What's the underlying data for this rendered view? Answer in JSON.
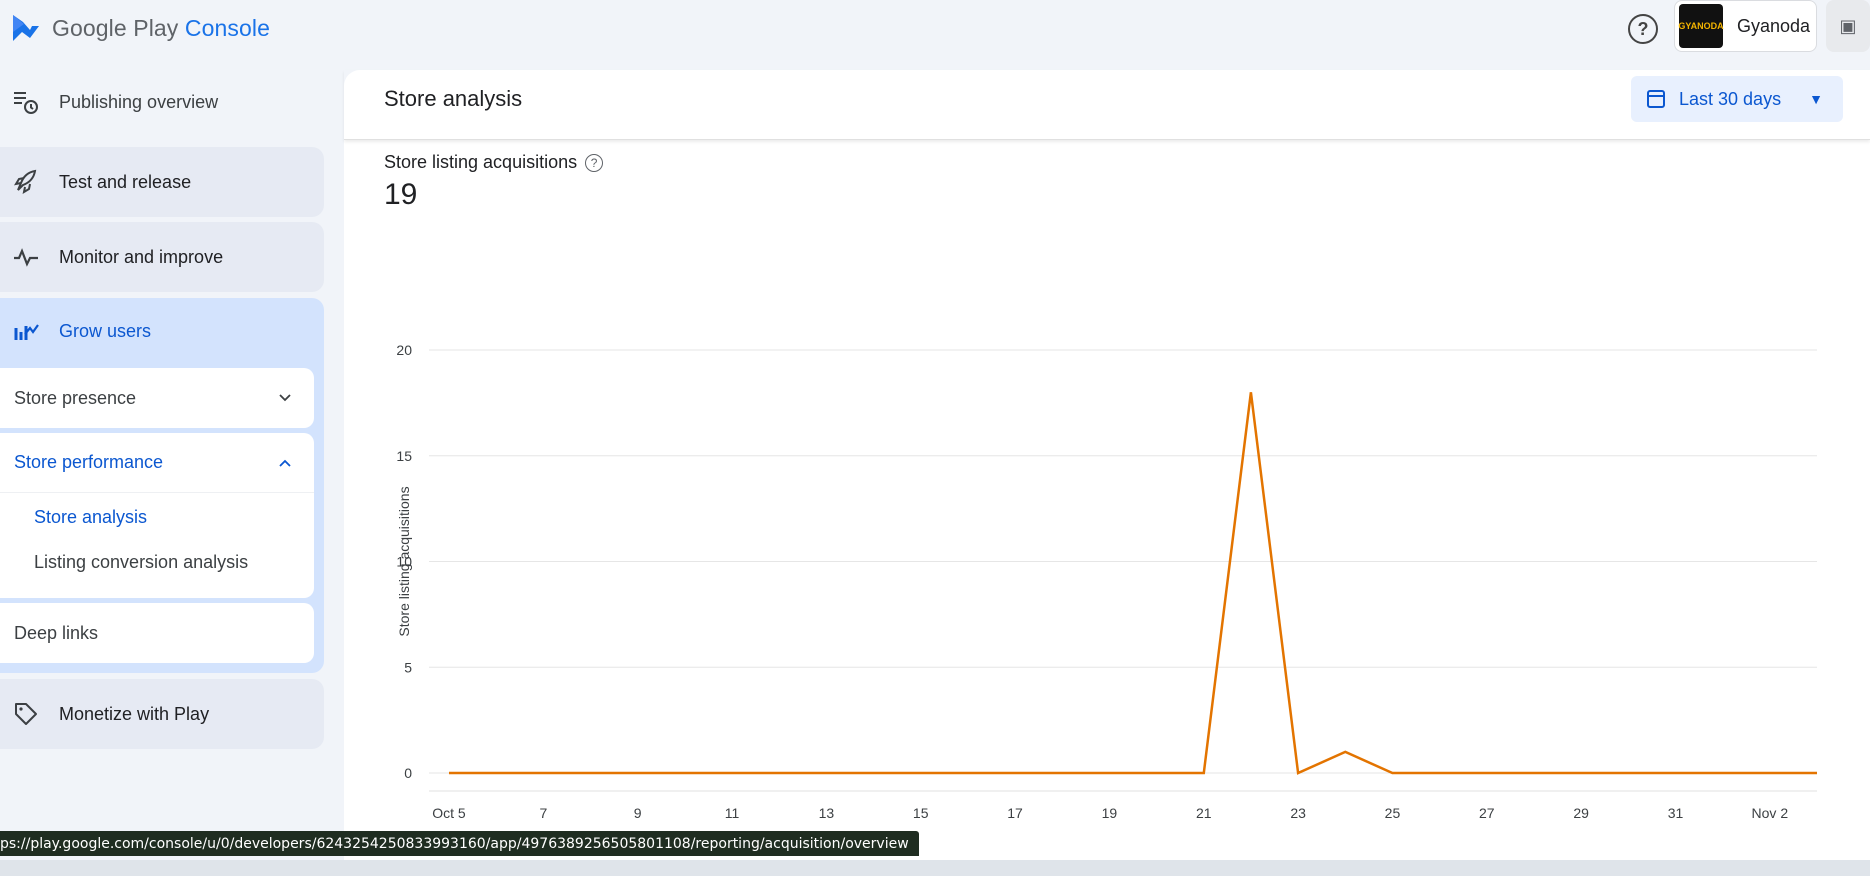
{
  "header": {
    "logo_google_play": "Google Play",
    "logo_console": "Console",
    "help_icon": "help-circle-icon",
    "account_name": "Gyanoda",
    "avatar_text": "GYANODA"
  },
  "sidebar": {
    "publishing_overview": "Publishing overview",
    "test_and_release": "Test and release",
    "monitor_and_improve": "Monitor and improve",
    "grow_users": "Grow users",
    "store_presence": "Store presence",
    "store_performance": "Store performance",
    "store_analysis": "Store analysis",
    "listing_conversion": "Listing conversion analysis",
    "deep_links": "Deep links",
    "monetize": "Monetize with Play"
  },
  "main": {
    "title": "Store analysis",
    "date_range": "Last 30 days",
    "metric_label": "Store listing acquisitions",
    "metric_value": "19"
  },
  "chart_data": {
    "type": "line",
    "ylabel": "Store listing acquisitions",
    "ylim": [
      0,
      20
    ],
    "yticks": [
      0,
      5,
      10,
      15,
      20
    ],
    "xticks": [
      "Oct 5",
      "7",
      "9",
      "11",
      "13",
      "15",
      "17",
      "19",
      "21",
      "23",
      "25",
      "27",
      "29",
      "31",
      "Nov 2"
    ],
    "x": [
      "Oct 5",
      "Oct 6",
      "Oct 7",
      "Oct 8",
      "Oct 9",
      "Oct 10",
      "Oct 11",
      "Oct 12",
      "Oct 13",
      "Oct 14",
      "Oct 15",
      "Oct 16",
      "Oct 17",
      "Oct 18",
      "Oct 19",
      "Oct 20",
      "Oct 21",
      "Oct 22",
      "Oct 23",
      "Oct 24",
      "Oct 25",
      "Oct 26",
      "Oct 27",
      "Oct 28",
      "Oct 29",
      "Oct 30",
      "Oct 31",
      "Nov 1",
      "Nov 2",
      "Nov 3"
    ],
    "series": [
      {
        "color": "#e37400",
        "values": [
          0,
          0,
          0,
          0,
          0,
          0,
          0,
          0,
          0,
          0,
          0,
          0,
          0,
          0,
          0,
          0,
          0,
          18,
          0,
          1,
          0,
          0,
          0,
          0,
          0,
          0,
          0,
          0,
          0,
          0
        ]
      }
    ],
    "grid": true
  },
  "status_url": "ps://play.google.com/console/u/0/developers/6243254250833993160/app/4976389256505801108/reporting/acquisition/overview"
}
